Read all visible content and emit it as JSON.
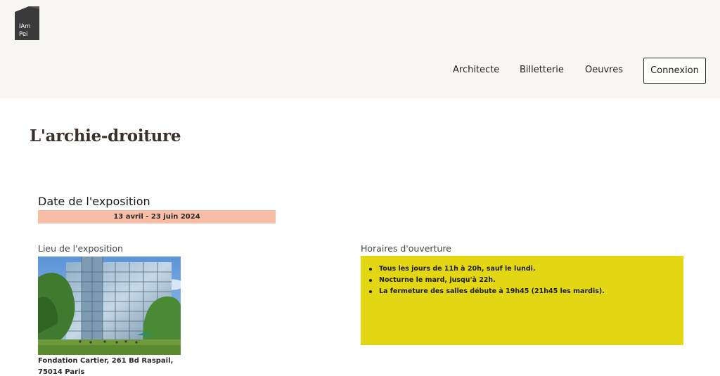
{
  "header": {
    "logo_line1": "IAm",
    "logo_line2": "Pei",
    "nav": {
      "architecte": "Architecte",
      "billetterie": "Billetterie",
      "oeuvres": "Oeuvres",
      "connexion": "Connexion"
    }
  },
  "main": {
    "title": "L'archie-droiture",
    "date_section": {
      "heading": "Date de l'exposition",
      "dates": "13 avril - 23 juin 2024"
    },
    "lieu": {
      "label": "Lieu de l'exposition",
      "image_subject": "Fondation Cartier glass building photo",
      "address_line1": "Fondation Cartier, 261 Bd Raspail,",
      "address_line2": "75014 Paris"
    },
    "horaires": {
      "label": "Horaires d'ouverture",
      "items": [
        "Tous les jours de 11h à 20h, sauf le lundi.",
        "Nocturne le mard, jusqu'à 22h.",
        "La fermeture des salles débute à 19h45 (21h45 les mardis)."
      ]
    }
  },
  "colors": {
    "header_bg": "#f8f7f4",
    "date_bar": "#f8bda6",
    "horaires_box": "#e3d713",
    "title": "#3b2f2a"
  }
}
